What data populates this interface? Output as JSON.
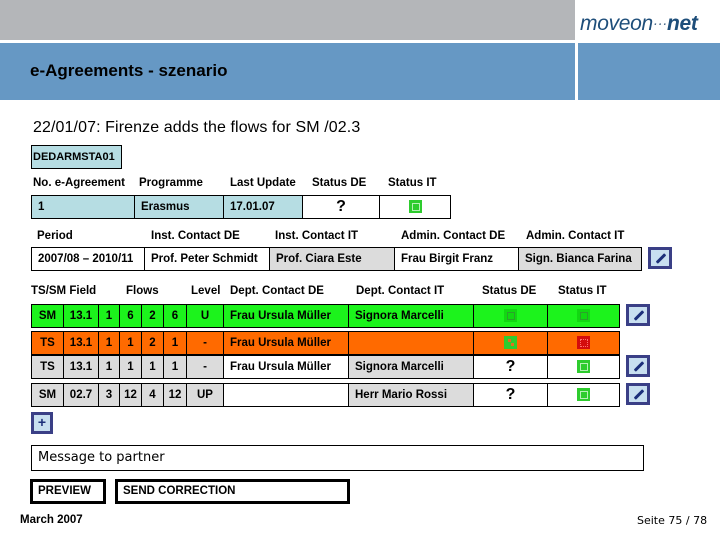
{
  "header": {
    "logo": {
      "left": "moveon",
      "dots": "···",
      "right": "net"
    },
    "title": "e-Agreements - szenario"
  },
  "subtitle": "22/01/07: Firenze adds the flows for SM /02.3",
  "agreement_code": "DEDARMSTA01",
  "agreement": {
    "headers": [
      "No. e-Agreement",
      "Programme",
      "Last Update",
      "Status DE",
      "Status IT"
    ],
    "row": {
      "number": "1",
      "programme": "Erasmus",
      "last_update": "17.01.07",
      "status_de": "?",
      "status_it": "checked"
    }
  },
  "contacts": {
    "headers": [
      "Period",
      "Inst. Contact DE",
      "Inst. Contact IT",
      "Admin. Contact DE",
      "Admin. Contact IT"
    ],
    "row": {
      "period": "2007/08 – 2010/11",
      "inst_de": "Prof. Peter Schmidt",
      "inst_it": "Prof. Ciara Este",
      "admin_de": "Frau Birgit Franz",
      "admin_it": "Sign. Bianca Farina"
    },
    "edit_icon": "pencil-icon"
  },
  "flows": {
    "headers": [
      "TS/SM",
      "Field",
      "Flows",
      "Level",
      "Dept. Contact DE",
      "Dept. Contact IT",
      "Status DE",
      "Status IT"
    ],
    "rows": [
      {
        "type": "SM",
        "field": "13.1",
        "f1": "1",
        "f2": "6",
        "f3": "2",
        "f4": "6",
        "level": "U",
        "dept_de": "Frau Ursula Müller",
        "dept_it": "Signora Marcelli",
        "status_de": "checked",
        "status_it": "checked",
        "highlight": "green",
        "editable": true
      },
      {
        "type": "TS",
        "field": "13.1",
        "f1": "1",
        "f2": "1",
        "f3": "2",
        "f4": "1",
        "level": "-",
        "dept_de": "Frau Ursula Müller",
        "dept_it": "",
        "status_de": "mixed",
        "status_it": "rejected",
        "highlight": "orange",
        "editable": false
      },
      {
        "type": "TS",
        "field": "13.1",
        "f1": "1",
        "f2": "1",
        "f3": "1",
        "f4": "1",
        "level": "-",
        "dept_de": "Frau Ursula Müller",
        "dept_it": "Signora Marcelli",
        "status_de": "?",
        "status_it": "checked",
        "highlight": "none",
        "editable": true
      },
      {
        "type": "SM",
        "field": "02.7",
        "f1": "3",
        "f2": "12",
        "f3": "4",
        "f4": "12",
        "level": "UP",
        "dept_de": "",
        "dept_it": "Herr Mario Rossi",
        "status_de": "?",
        "status_it": "checked",
        "highlight": "none",
        "editable": true
      }
    ],
    "add_label": "+"
  },
  "message": {
    "placeholder": "Message to partner"
  },
  "buttons": {
    "preview": "PREVIEW",
    "send": "SEND CORRECTION"
  },
  "footer": {
    "date": "March 2007",
    "page": "Seite 75 / 78"
  },
  "colors": {
    "header_gray": "#b4b6b9",
    "title_blue": "#6698c4",
    "light_blue": "#b6dde3",
    "row_green": "#1cf31c",
    "row_orange": "#ff6a00",
    "cell_gray": "#dcdcdc",
    "edit_border": "#3a3f86"
  }
}
